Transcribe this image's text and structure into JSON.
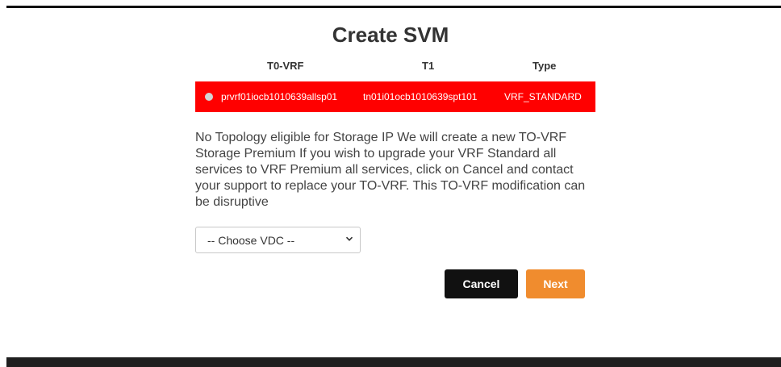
{
  "dialog": {
    "title": "Create SVM",
    "table": {
      "headers": [
        "T0-VRF",
        "T1",
        "Type"
      ],
      "rows": [
        {
          "t0_vrf": "prvrf01iocb1010639allsp01",
          "t1": "tn01i01ocb1010639spt101",
          "type": "VRF_STANDARD",
          "selected": true
        }
      ]
    },
    "message": "No Topology eligible for Storage IP We will create a new TO-VRF Storage Premium If you wish to upgrade your VRF Standard all services to VRF Premium all services, click on Cancel and contact your support to replace your TO-VRF. This TO-VRF modification can be disruptive",
    "vdc_select": {
      "value": "-- Choose VDC --",
      "icon": "chevron-down-icon"
    },
    "buttons": {
      "cancel": "Cancel",
      "next": "Next"
    }
  },
  "colors": {
    "row_highlight": "#ff0000",
    "next_button": "#f08c2e",
    "cancel_button": "#111111",
    "footer": "#1f1f1f"
  }
}
